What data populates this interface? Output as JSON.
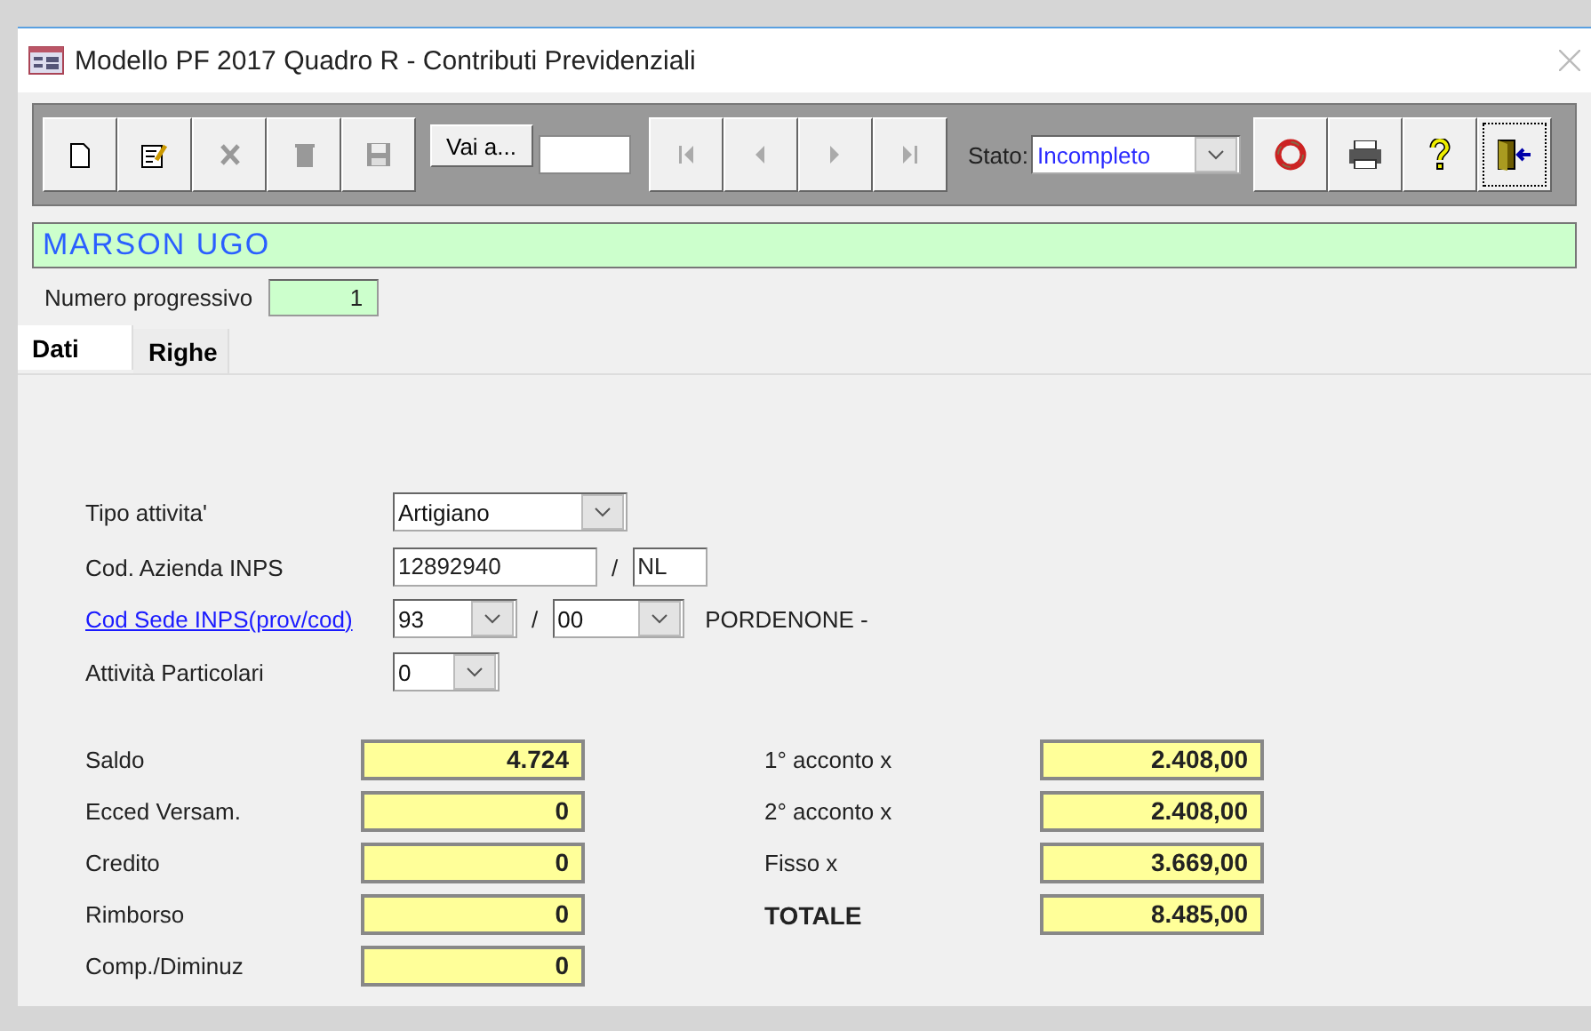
{
  "window": {
    "title": "Modello PF 2017 Quadro R - Contributi Previdenziali"
  },
  "toolbar": {
    "edit_buttons": [
      {
        "disabled": false
      },
      {
        "disabled": false
      },
      {
        "disabled": true
      },
      {
        "disabled": true
      },
      {
        "disabled": true
      }
    ],
    "goto_button": "Vai a...",
    "nav_buttons": [
      {
        "disabled": true
      },
      {
        "disabled": true
      },
      {
        "disabled": true
      },
      {
        "disabled": true
      }
    ],
    "status_label": "Stato:",
    "status_value": "Incompleto",
    "action_buttons": [
      {
        "focused": false
      },
      {
        "focused": false
      },
      {
        "focused": false
      },
      {
        "focused": true
      }
    ]
  },
  "header": {
    "name": "MARSON UGO",
    "progressive_label": "Numero progressivo",
    "progressive_value": "1"
  },
  "tabs": [
    {
      "label": "Dati",
      "selected": true
    },
    {
      "label": "Righe",
      "selected": false
    }
  ],
  "form": {
    "tipo_attivita": {
      "label": "Tipo attivita'",
      "value": "Artigiano"
    },
    "cod_azienda": {
      "label": "Cod. Azienda INPS",
      "value": "12892940",
      "separator": "/",
      "suffix": "NL"
    },
    "cod_sede": {
      "label": "Cod Sede INPS(prov/cod)",
      "prov": "93",
      "separator": "/",
      "cod": "00",
      "place": "PORDENONE -"
    },
    "attivita_particolari": {
      "label": "Attività Particolari",
      "value": "0"
    },
    "amounts_left": [
      {
        "label": "Saldo",
        "value": "4.724"
      },
      {
        "label": "Ecced Versam.",
        "value": "0"
      },
      {
        "label": "Credito",
        "value": "0"
      },
      {
        "label": "Rimborso",
        "value": "0"
      },
      {
        "label": "Comp./Diminuz",
        "value": "0"
      }
    ],
    "amounts_right": [
      {
        "label": "1° acconto x",
        "value": "2.408,00",
        "kind": "amount"
      },
      {
        "label": "2° acconto x",
        "value": "2.408,00",
        "kind": "amount"
      },
      {
        "label": "Fisso x",
        "value": "3.669,00",
        "kind": "amount"
      },
      {
        "label": "TOTALE",
        "value": "8.485,00",
        "kind": "total"
      }
    ]
  }
}
